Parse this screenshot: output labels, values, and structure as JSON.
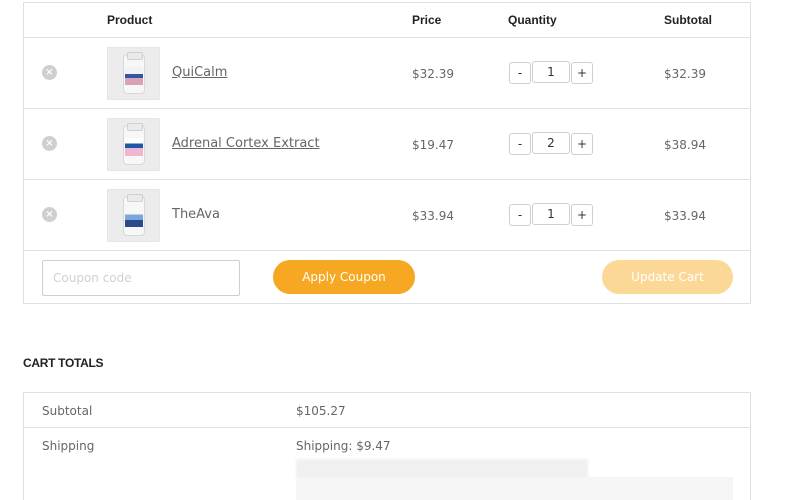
{
  "cart": {
    "headers": {
      "product": "Product",
      "price": "Price",
      "quantity": "Quantity",
      "subtotal": "Subtotal"
    },
    "items": [
      {
        "name": "QuiCalm",
        "price": "$32.39",
        "quantity": "1",
        "subtotal": "$32.39",
        "is_link": true
      },
      {
        "name": "Adrenal Cortex Extract",
        "price": "$19.47",
        "quantity": "2",
        "subtotal": "$38.94",
        "is_link": true
      },
      {
        "name": "TheAva",
        "price": "$33.94",
        "quantity": "1",
        "subtotal": "$33.94",
        "is_link": false
      }
    ],
    "remove_icon": "close-circle-icon",
    "qty_minus_label": "-",
    "qty_plus_label": "+"
  },
  "actions": {
    "coupon_placeholder": "Coupon code",
    "apply_coupon_label": "Apply Coupon",
    "update_cart_label": "Update Cart"
  },
  "totals": {
    "heading": "CART TOTALS",
    "subtotal_label": "Subtotal",
    "subtotal_value": "$105.27",
    "shipping_label": "Shipping",
    "shipping_value": "Shipping: $9.47"
  },
  "colors": {
    "accent": "#f7a823",
    "accent_disabled": "#fbd896",
    "border": "#e1e1e1"
  }
}
